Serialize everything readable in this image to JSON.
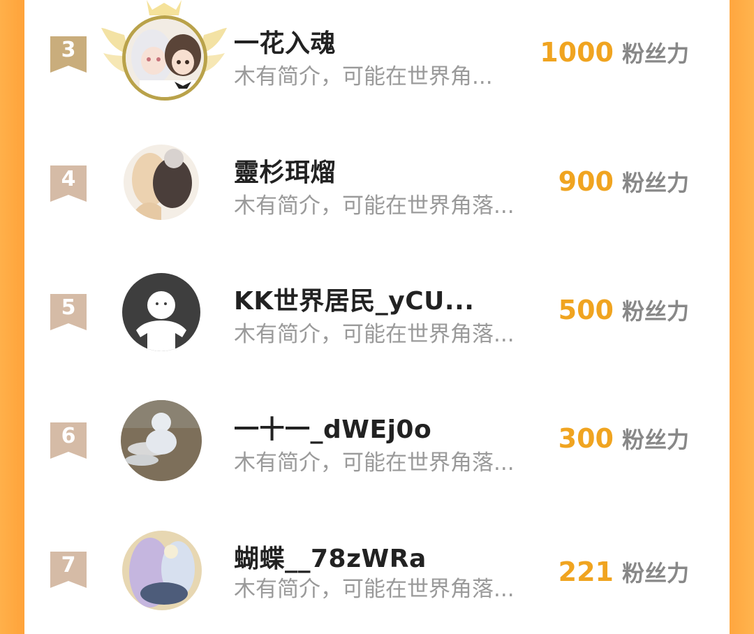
{
  "unit_label": "粉丝力",
  "colors": {
    "accent": "#f0a420",
    "side_gradient": "#ffa33a",
    "rank_badge": "#d3b8a4",
    "gold_ring": "#b9a24a"
  },
  "rows": [
    {
      "rank": "3",
      "name": "一花入魂",
      "intro": "木有简介，可能在世界角...",
      "score": "1000",
      "avatar": "anime-two-girls-avatar"
    },
    {
      "rank": "4",
      "name": "靈杉珥熘",
      "intro": "木有简介，可能在世界角落...",
      "score": "900",
      "avatar": "anime-couple-avatar"
    },
    {
      "rank": "5",
      "name": "KK世界居民_yCU...",
      "intro": "木有简介，可能在世界角落...",
      "score": "500",
      "avatar": "default-user-avatar"
    },
    {
      "rank": "6",
      "name": "一十一_dWEj0o",
      "intro": "木有简介，可能在世界角落...",
      "score": "300",
      "avatar": "snowman-photo-avatar"
    },
    {
      "rank": "7",
      "name": "蝴蝶__78zWRa",
      "intro": "木有简介，可能在世界角落...",
      "score": "221",
      "avatar": "fantasy-art-avatar"
    }
  ]
}
